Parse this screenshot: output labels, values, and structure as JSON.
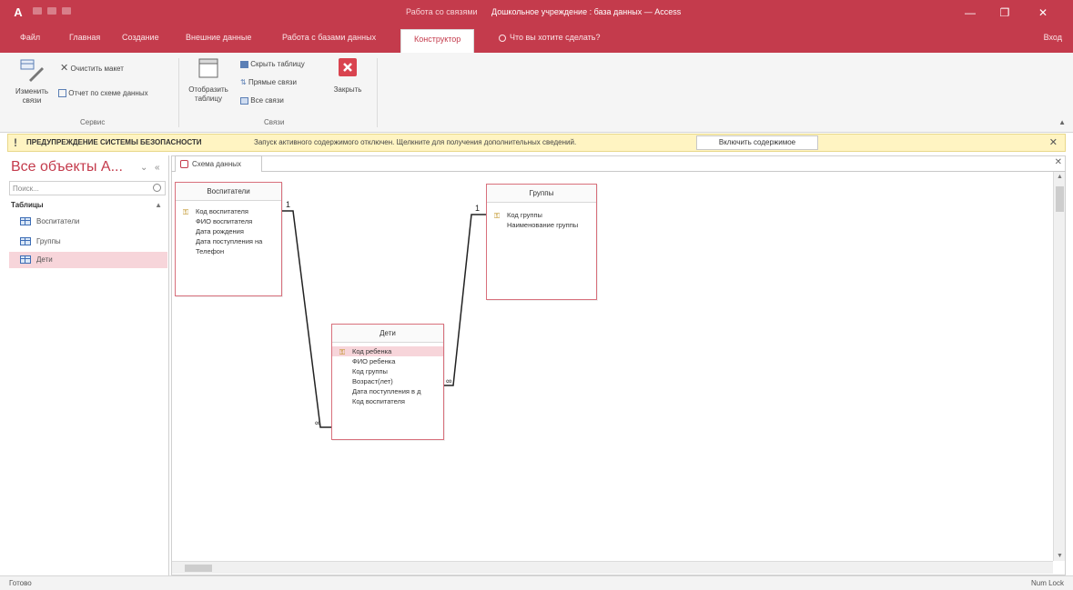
{
  "titlebar": {
    "app_icon": "A",
    "context_tab": "Работа со связями",
    "title": "Дошкольное учреждение : база данных — Access",
    "minimize": "—",
    "restore": "❐",
    "close": "✕"
  },
  "tabs": [
    {
      "label": "Файл"
    },
    {
      "label": "Главная"
    },
    {
      "label": "Создание"
    },
    {
      "label": "Внешние данные"
    },
    {
      "label": "Работа с базами данных"
    },
    {
      "label": "Конструктор",
      "active": true
    }
  ],
  "tellme": "Что вы хотите сделать?",
  "share": "Вход",
  "ribbon": {
    "change_links": "Изменить связи",
    "clear_layout": "Очистить макет",
    "relationship_report": "Отчет по схеме данных",
    "group_tools": "Сервис",
    "show_table": "Отобразить таблицу",
    "hide_table": "Скрыть таблицу",
    "direct_links": "Прямые связи",
    "all_links": "Все связи",
    "group_links": "Связи",
    "close": "Закрыть"
  },
  "msgbar": {
    "title": "ПРЕДУПРЕЖДЕНИЕ СИСТЕМЫ БЕЗОПАСНОСТИ",
    "text": "Запуск активного содержимого отключен. Щелкните для получения дополнительных сведений.",
    "button": "Включить содержимое",
    "close": "✕"
  },
  "nav": {
    "title": "Все объекты А...",
    "search_placeholder": "Поиск...",
    "group": "Таблицы",
    "group_caret": "▲",
    "items": [
      {
        "label": "Воспитатели"
      },
      {
        "label": "Группы"
      },
      {
        "label": "Дети"
      }
    ]
  },
  "doc_tab": {
    "label": "Схема данных",
    "close": "✕"
  },
  "tables": {
    "t1": {
      "title": "Воспитатели",
      "fields": [
        "Код воспитателя",
        "ФИО воспитателя",
        "Дата рождения",
        "Дата поступления на",
        "Телефон"
      ]
    },
    "t2": {
      "title": "Группы",
      "fields": [
        "Код группы",
        "Наименование группы"
      ]
    },
    "t3": {
      "title": "Дети",
      "fields": [
        "Код ребенка",
        "ФИО ребенка",
        "Код группы",
        "Возраст(лет)",
        "Дата поступления в д",
        "Код воспитателя"
      ]
    }
  },
  "relations": {
    "one": "1",
    "many": "∞"
  },
  "status": {
    "left": "Готово",
    "right": "Num Lock"
  }
}
